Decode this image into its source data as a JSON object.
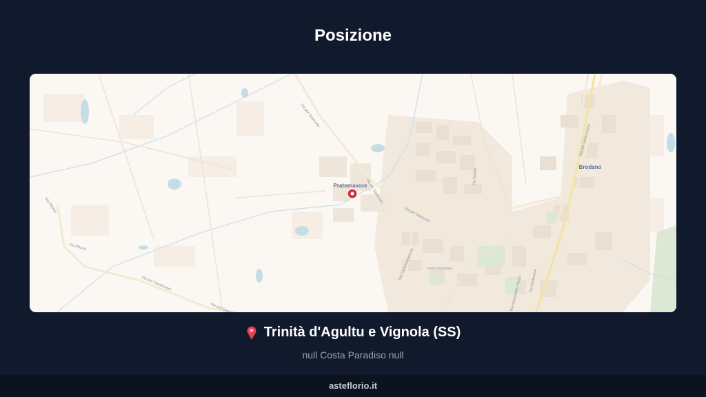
{
  "page": {
    "title": "Posizione"
  },
  "map": {
    "place_labels": {
      "pratomavore": "Pratomavore",
      "brodano": "Brodano",
      "parco": "PARCO EUROPA"
    },
    "road_labels": {
      "via_per_sassuolo_north": "Via per Sassuolo",
      "via_per_sassuolo_mid": "Via per Sassuolo",
      "via_per_sassuolo_east": "Via per Sassuolo",
      "via_pilonia": "Via Pilonia",
      "via_pilonia_sw": "Via Pilonia",
      "via_per_castelvetro": "Via per Castelvetro",
      "via_per_castelvetro_2": "Via per Castelvetro",
      "via_circonvallazione": "Via Circonvallazione",
      "via_basilia": "Via Basilia",
      "via_per_spilamberto": "Via per Spilamberto",
      "via_alessandro_plessi": "Via Alessandro Plessi",
      "via_modenese": "Via Modenese"
    },
    "marker": "location-pin-icon"
  },
  "location": {
    "title": "Trinità d'Agultu e Vignola (SS)",
    "address": "null Costa Paradiso null",
    "icon": "map-pin-icon"
  },
  "footer": {
    "brand": "asteflorio.it"
  },
  "colors": {
    "background": "#111a2c",
    "map_base": "#fbf7f2",
    "water": "#c4dde6",
    "marker": "#d0343f"
  }
}
